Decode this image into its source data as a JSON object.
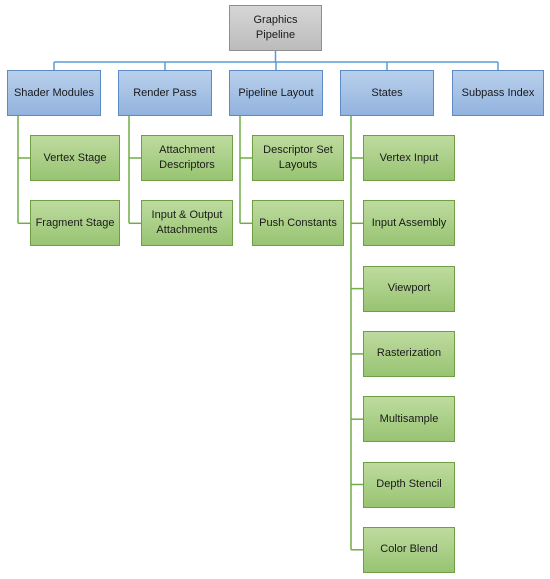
{
  "root": {
    "label": "Graphics\nPipeline"
  },
  "categories": [
    {
      "label": "Shader Modules",
      "children": [
        "Vertex  Stage",
        "Fragment Stage"
      ]
    },
    {
      "label": "Render Pass",
      "children": [
        "Attachment\nDescriptors",
        "Input & Output\nAttachments"
      ]
    },
    {
      "label": "Pipeline Layout",
      "children": [
        "Descriptor Set\nLayouts",
        "Push Constants"
      ]
    },
    {
      "label": "States",
      "children": [
        "Vertex  Input",
        "Input Assembly",
        "Viewport",
        "Rasterization",
        "Multisample",
        "Depth Stencil",
        "Color Blend"
      ]
    },
    {
      "label": "Subpass Index",
      "children": []
    }
  ],
  "colors": {
    "root_line": "#5b9bd5",
    "leaf_line": "#70ad47"
  }
}
